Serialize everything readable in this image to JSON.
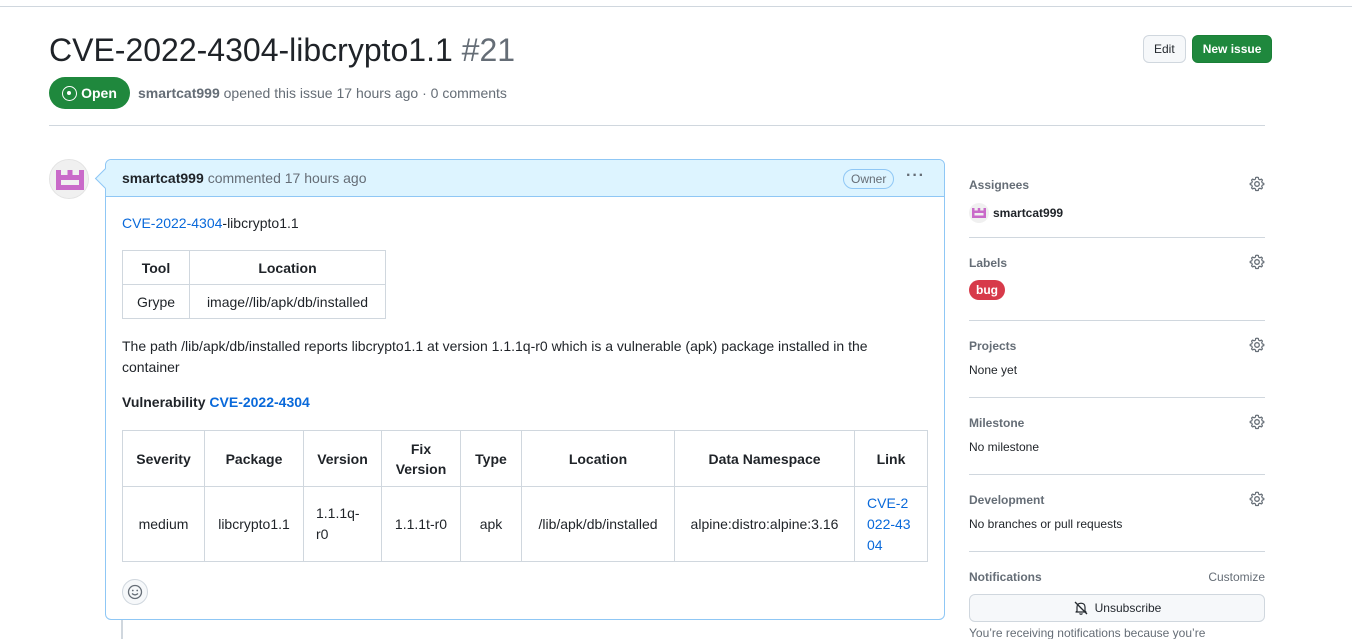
{
  "issue": {
    "title": "CVE-2022-4304-libcrypto1.1",
    "number": "#21",
    "state": "Open",
    "author": "smartcat999",
    "meta_text": "opened this issue 17 hours ago · 0 comments",
    "edit_label": "Edit",
    "new_issue_label": "New issue"
  },
  "comment": {
    "author": "smartcat999",
    "action": "commented 17 hours ago",
    "role_badge": "Owner",
    "menu": "···",
    "intro_link": "CVE-2022-4304",
    "intro_rest": "-libcrypto1.1",
    "table1": {
      "headers": [
        "Tool",
        "Location"
      ],
      "row": [
        "Grype",
        "image//lib/apk/db/installed"
      ]
    },
    "paragraph": "The path /lib/apk/db/installed reports libcrypto1.1 at version 1.1.1q-r0 which is a vulnerable (apk) package installed in the container",
    "vuln_label": "Vulnerability",
    "vuln_link": "CVE-2022-4304",
    "table2": {
      "headers": [
        "Severity",
        "Package",
        "Version",
        "Fix Version",
        "Type",
        "Location",
        "Data Namespace",
        "Link"
      ],
      "row": [
        "medium",
        "libcrypto1.1",
        "1.1.1q-r0",
        "1.1.1t-r0",
        "apk",
        "/lib/apk/db/installed",
        "alpine:distro:alpine:3.16",
        "CVE-2022-4304"
      ]
    }
  },
  "sidebar": {
    "assignees": {
      "title": "Assignees",
      "value": "smartcat999"
    },
    "labels": {
      "title": "Labels",
      "value": "bug",
      "color": "#d73a4a"
    },
    "projects": {
      "title": "Projects",
      "value": "None yet"
    },
    "milestone": {
      "title": "Milestone",
      "value": "No milestone"
    },
    "development": {
      "title": "Development",
      "value": "No branches or pull requests"
    },
    "notifications": {
      "title": "Notifications",
      "customize": "Customize",
      "unsubscribe": "Unsubscribe",
      "note": "You’re receiving notifications because you’re"
    }
  },
  "colors": {
    "accent": "#0969da",
    "open": "#1f883d",
    "comment_header": "#ddf4ff"
  }
}
